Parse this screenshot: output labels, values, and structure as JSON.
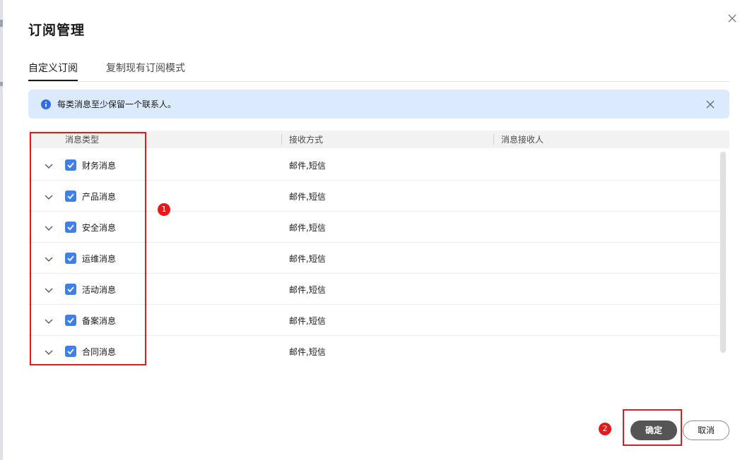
{
  "dialog": {
    "title": "订阅管理",
    "tabs": [
      {
        "label": "自定义订阅",
        "active": true
      },
      {
        "label": "复制现有订阅模式",
        "active": false
      }
    ],
    "notice": {
      "text": "每类消息至少保留一个联系人。",
      "icon": "info-icon"
    },
    "table": {
      "headers": [
        "消息类型",
        "接收方式",
        "消息接收人"
      ],
      "rows": [
        {
          "name": "财务消息",
          "method": "邮件,短信",
          "checked": true
        },
        {
          "name": "产品消息",
          "method": "邮件,短信",
          "checked": true
        },
        {
          "name": "安全消息",
          "method": "邮件,短信",
          "checked": true
        },
        {
          "name": "运维消息",
          "method": "邮件,短信",
          "checked": true
        },
        {
          "name": "活动消息",
          "method": "邮件,短信",
          "checked": true
        },
        {
          "name": "备案消息",
          "method": "邮件,短信",
          "checked": true
        },
        {
          "name": "合同消息",
          "method": "邮件,短信",
          "checked": true
        }
      ]
    },
    "buttons": {
      "confirm": "确定",
      "cancel": "取消"
    },
    "annotations": {
      "badge_1": "1",
      "badge_2": "2"
    }
  },
  "colors": {
    "accent": "#3f7fe6",
    "notice_bg": "#dbeafe",
    "highlight": "#e11b1b",
    "confirm_bg": "#555555"
  }
}
